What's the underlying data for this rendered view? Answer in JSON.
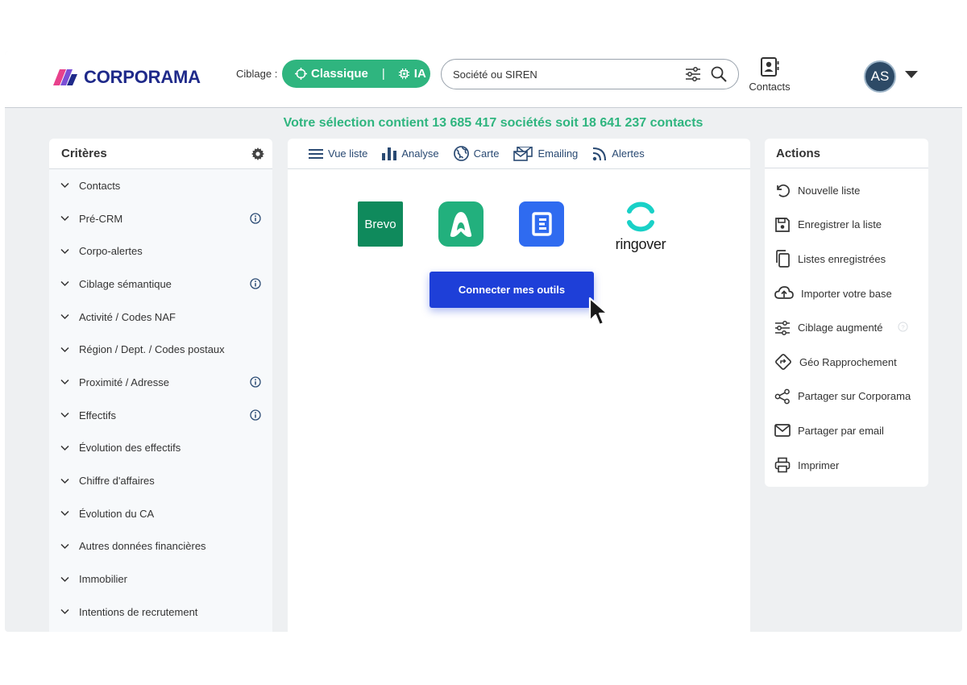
{
  "header": {
    "logo_text": "CORPORAMA",
    "ciblage_label": "Ciblage :",
    "toggle": {
      "option1": "Classique",
      "option2": "IA",
      "separator": "|"
    },
    "search": {
      "placeholder": "Société ou SIREN"
    },
    "contacts_label": "Contacts",
    "avatar_initials": "AS"
  },
  "selection_text": "Votre sélection contient 13 685 417 sociétés soit 18 641 237 contacts",
  "criteria": {
    "title": "Critères",
    "items": [
      {
        "label": "Contacts",
        "info": false
      },
      {
        "label": "Pré-CRM",
        "info": true
      },
      {
        "label": "Corpo-alertes",
        "info": false
      },
      {
        "label": "Ciblage sémantique",
        "info": true
      },
      {
        "label": "Activité / Codes NAF",
        "info": false
      },
      {
        "label": "Région / Dept. / Codes postaux",
        "info": false
      },
      {
        "label": "Proximité / Adresse",
        "info": true
      },
      {
        "label": "Effectifs",
        "info": true
      },
      {
        "label": "Évolution des effectifs",
        "info": false
      },
      {
        "label": "Chiffre d'affaires",
        "info": false
      },
      {
        "label": "Évolution du CA",
        "info": false
      },
      {
        "label": "Autres données financières",
        "info": false
      },
      {
        "label": "Immobilier",
        "info": false
      },
      {
        "label": "Intentions de recrutement",
        "info": false
      }
    ]
  },
  "tabs": [
    {
      "label": "Vue liste",
      "icon": "list-icon"
    },
    {
      "label": "Analyse",
      "icon": "bar-chart-icon"
    },
    {
      "label": "Carte",
      "icon": "globe-icon"
    },
    {
      "label": "Emailing",
      "icon": "emailing-icon"
    },
    {
      "label": "Alertes",
      "icon": "rss-icon"
    }
  ],
  "tools": {
    "brevo": "Brevo",
    "ringover": "ringover"
  },
  "connect_button": "Connecter mes outils",
  "actions": {
    "title": "Actions",
    "items": [
      {
        "label": "Nouvelle liste",
        "icon": "undo-icon"
      },
      {
        "label": "Enregistrer la liste",
        "icon": "save-icon"
      },
      {
        "label": "Listes enregistrées",
        "icon": "copy-icon"
      },
      {
        "label": "Importer votre base",
        "icon": "cloud-upload-icon"
      },
      {
        "label": "Ciblage augmenté",
        "icon": "sliders-icon"
      },
      {
        "label": "Géo Rapprochement",
        "icon": "directions-icon"
      },
      {
        "label": "Partager sur Corporama",
        "icon": "share-icon"
      },
      {
        "label": "Partager par email",
        "icon": "mail-icon"
      },
      {
        "label": "Imprimer",
        "icon": "printer-icon"
      }
    ]
  },
  "colors": {
    "brand_green": "#2fb57f",
    "brand_navy": "#1f2a8a",
    "primary_button": "#1e3fd8",
    "tab_text": "#2a4a73"
  }
}
